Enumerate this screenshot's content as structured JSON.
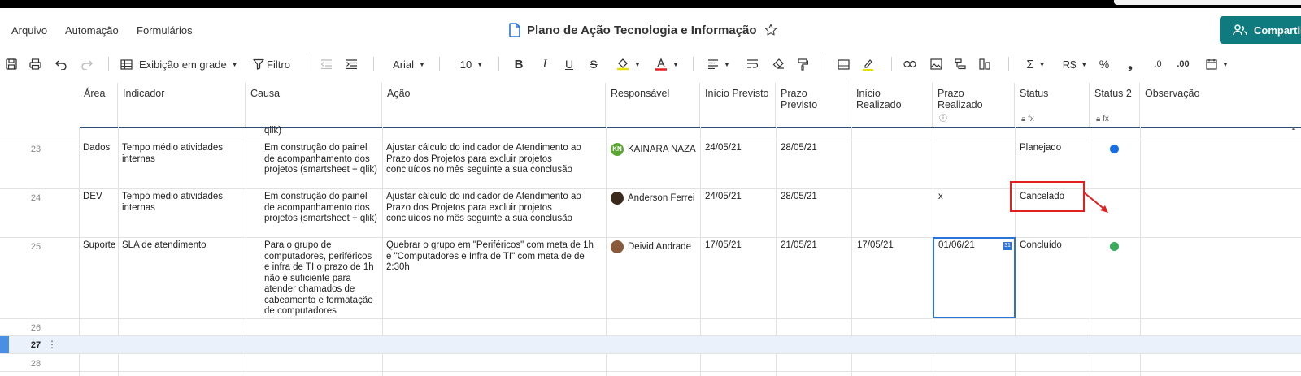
{
  "menu": {
    "items": [
      {
        "label": "Arquivo"
      },
      {
        "label": "Automação"
      },
      {
        "label": "Formulários"
      }
    ]
  },
  "document": {
    "title": "Plano de Ação Tecnologia e Informação",
    "share_label": "Compartil"
  },
  "toolbar": {
    "view_label": "Exibição em grade",
    "filter_label": "Filtro",
    "font": "Arial",
    "font_size": "10",
    "currency": "R$",
    "percent": "%",
    "decimal_less": ".0",
    "decimal_more": ".00",
    "accent_color": "#0f7b7f"
  },
  "columns": [
    {
      "label": "Área"
    },
    {
      "label": "Indicador"
    },
    {
      "label": "Causa"
    },
    {
      "label": "Ação"
    },
    {
      "label": "Responsável"
    },
    {
      "label": "Início Previsto"
    },
    {
      "label": "Prazo Previsto"
    },
    {
      "label": "Início Realizado"
    },
    {
      "label": "Prazo Realizado"
    },
    {
      "label": "Status"
    },
    {
      "label": "Status 2"
    },
    {
      "label": "Observação"
    }
  ],
  "partial_row_text": "qlik)",
  "rows": [
    {
      "num": "23",
      "area": "Dados",
      "indicador": "Tempo médio atividades internas",
      "causa": "Em construção do painel de acompanhamento dos projetos (smartsheet + qlik)",
      "acao": "Ajustar cálculo do indicador de Atendimento ao Prazo dos Projetos para excluir projetos concluídos no mês seguinte a sua conclusão",
      "responsavel": "KAINARA NAZA",
      "responsavel_initials": "KN",
      "inicio_previsto": "24/05/21",
      "prazo_previsto": "28/05/21",
      "inicio_realizado": "",
      "prazo_realizado": "",
      "status": "Planejado",
      "status2_color": "#1a6fe0"
    },
    {
      "num": "24",
      "area": "DEV",
      "indicador": "Tempo médio atividades internas",
      "causa": "Em construção do painel de acompanhamento dos projetos (smartsheet + qlik)",
      "acao": "Ajustar cálculo do indicador de Atendimento ao Prazo dos Projetos para excluir projetos concluídos no mês seguinte a sua conclusão",
      "responsavel": "Anderson Ferrei",
      "inicio_previsto": "24/05/21",
      "prazo_previsto": "28/05/21",
      "inicio_realizado": "",
      "prazo_realizado": "x",
      "status": "Cancelado",
      "status2_color": ""
    },
    {
      "num": "25",
      "area": "Suporte",
      "indicador": "SLA de atendimento",
      "causa": "Para o grupo de computadores, periféricos e infra de TI o prazo de 1h não é suficiente para atender chamados de cabeamento e formatação de computadores",
      "acao": "Quebrar o grupo em \"Periféricos\" com meta de 1h e \"Computadores e Infra de TI\" com meta de de 2:30h",
      "responsavel": "Deivid Andrade",
      "inicio_previsto": "17/05/21",
      "prazo_previsto": "21/05/21",
      "inicio_realizado": "17/05/21",
      "prazo_realizado": "01/06/21",
      "status": "Concluído",
      "status2_color": "#3aaa5c"
    }
  ],
  "empty_rows": [
    "26",
    "27",
    "28"
  ]
}
